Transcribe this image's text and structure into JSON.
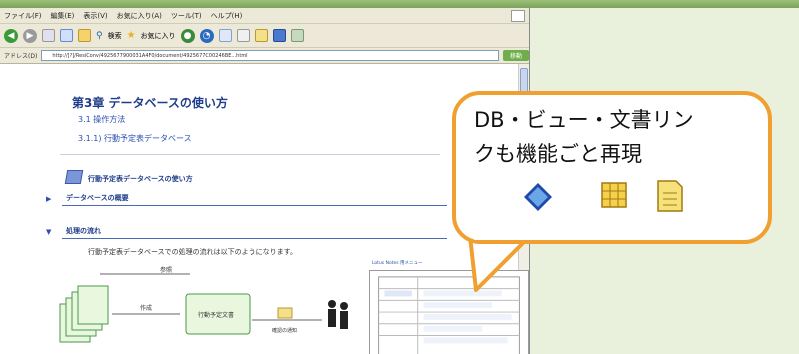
{
  "menu": [
    "ファイル(F)",
    "編集(E)",
    "表示(V)",
    "お気に入り(A)",
    "ツール(T)",
    "ヘルプ(H)"
  ],
  "toolbar": {
    "search_label": "検索",
    "favorites_label": "お気に入り"
  },
  "address": {
    "label": "アドレス(D)",
    "url": "http://[?]/ResiConv/4925677900031A4F0/document/4925677C00246BE...html",
    "go_label": "移動"
  },
  "page": {
    "chapter_title": "第3章 データベースの使い方",
    "link1": "3.1 操作方法",
    "link2": "3.1.1) 行動予定表データベース",
    "subheading": "行動予定表データベースの使い方",
    "section1": "データベースの概要",
    "section2": "処理の流れ",
    "flow_text": "行動予定表データベースでの処理の流れは以下のようになります。",
    "panel_title": "Lotus Notes 用メニュー"
  },
  "diagram": {
    "label_top": "参照",
    "label_mid": "作成",
    "label_doc": "行動予定文書",
    "label_notify": "確認の通知"
  },
  "bubble": {
    "line1": "DB・ビュー・文書リン",
    "line2": "クも機能ごと再現",
    "icons": [
      "database-icon",
      "view-icon",
      "document-icon"
    ]
  },
  "colors": {
    "bubble_border": "#f0a030",
    "heading": "#1f3d8a",
    "link": "#2a4fb0"
  }
}
